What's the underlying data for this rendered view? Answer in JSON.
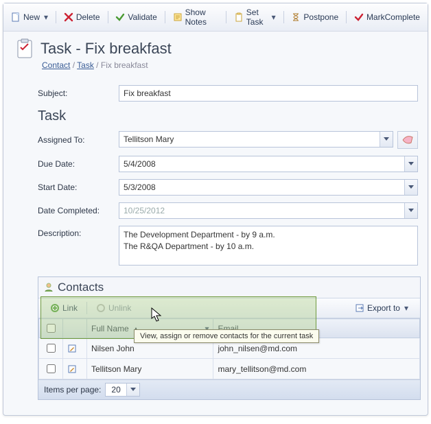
{
  "toolbar": {
    "new": "New",
    "delete": "Delete",
    "validate": "Validate",
    "show_notes": "Show Notes",
    "set_task": "Set Task",
    "postpone": "Postpone",
    "mark_complete": "MarkComplete"
  },
  "page": {
    "title": "Task - Fix breakfast",
    "crumb_contact": "Contact",
    "crumb_task": "Task",
    "crumb_current": "Fix breakfast"
  },
  "form": {
    "subject_label": "Subject:",
    "subject_value": "Fix breakfast",
    "section_task": "Task",
    "assigned_label": "Assigned To:",
    "assigned_value": "Tellitson Mary",
    "due_label": "Due Date:",
    "due_value": "5/4/2008",
    "start_label": "Start Date:",
    "start_value": "5/3/2008",
    "completed_label": "Date Completed:",
    "completed_value": "10/25/2012",
    "description_label": "Description:",
    "description_value": "The Development Department - by 9 a.m.\nThe R&QA Department - by 10 a.m."
  },
  "contacts": {
    "title": "Contacts",
    "tb": {
      "link": "Link",
      "unlink": "Unlink",
      "export": "Export to"
    },
    "tooltip": "View, assign or remove contacts for the current task",
    "cols": {
      "full_name": "Full Name",
      "email": "Email"
    },
    "rows": [
      {
        "full_name": "Nilsen John",
        "email": "john_nilsen@md.com"
      },
      {
        "full_name": "Tellitson Mary",
        "email": "mary_tellitson@md.com"
      }
    ],
    "pager_label": "Items per page:",
    "pager_value": "20"
  }
}
